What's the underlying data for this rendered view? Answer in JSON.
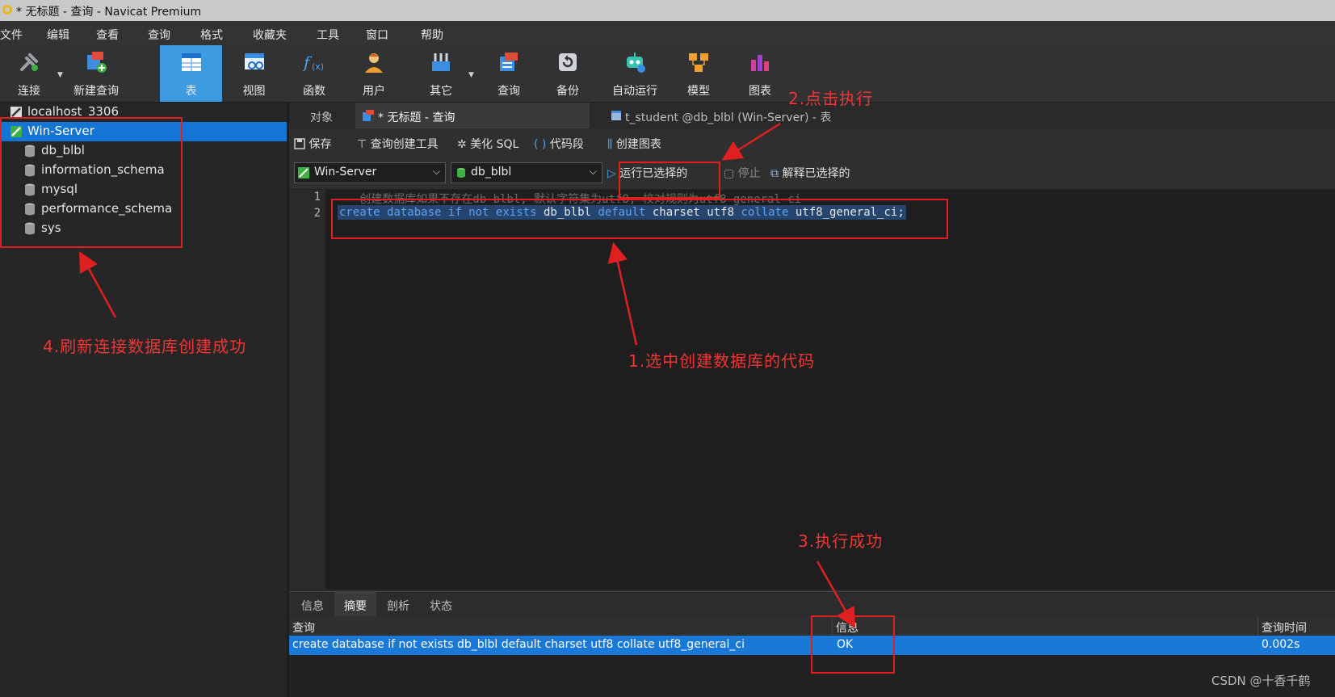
{
  "window": {
    "title": "* 无标题 - 查询 - Navicat Premium"
  },
  "menu": [
    "文件",
    "编辑",
    "查看",
    "查询",
    "格式",
    "收藏夹",
    "工具",
    "窗口",
    "帮助"
  ],
  "toolbar": {
    "connect": "连接",
    "new_query": "新建查询",
    "table": "表",
    "view": "视图",
    "function": "函数",
    "user": "用户",
    "other": "其它",
    "query": "查询",
    "backup": "备份",
    "automation": "自动运行",
    "model": "模型",
    "chart": "图表"
  },
  "tree": {
    "localhost": "localhost_3306",
    "server": "Win-Server",
    "databases": [
      "db_blbl",
      "information_schema",
      "mysql",
      "performance_schema",
      "sys"
    ]
  },
  "tabs": {
    "objects": "对象",
    "query_tab": "* 无标题 - 查询",
    "table_tab": "t_student @db_blbl (Win-Server) - 表"
  },
  "edit_toolbar": {
    "save": "保存",
    "query_builder": "查询创建工具",
    "beautify": "美化 SQL",
    "snippet": "代码段",
    "create_chart": "创建图表"
  },
  "conn_bar": {
    "connection": "Win-Server",
    "database": "db_blbl",
    "run_selected": "运行已选择的",
    "stop": "停止",
    "explain": "解释已选择的"
  },
  "editor": {
    "line_numbers": [
      "1",
      "2"
    ],
    "line1": "-- 创建数据库如果不存在db_blbl, 默认字符集为utf8, 校对规则为utf8_general_ci",
    "line2_tokens": {
      "t1": "create",
      "t2": "database",
      "t3": "if",
      "t4": "not",
      "t5": "exists",
      "t6": "db_blbl",
      "t7": "default",
      "t8": "charset",
      "t9": "utf8",
      "t10": "collate",
      "t11": "utf8_general_ci;"
    }
  },
  "results": {
    "tabs": [
      "信息",
      "摘要",
      "剖析",
      "状态"
    ],
    "headers": {
      "query": "查询",
      "info": "信息",
      "time": "查询时间"
    },
    "row": {
      "query": "create database if not exists db_blbl default charset utf8 collate utf8_general_ci",
      "info": "OK",
      "time": "0.002s"
    }
  },
  "annotations": {
    "a1": "1.选中创建数据库的代码",
    "a2": "2.点击执行",
    "a3": "3.执行成功",
    "a4": "4.刷新连接数据库创建成功"
  },
  "watermark": "CSDN @十香千鹤",
  "colors": {
    "accent": "#1575d4",
    "annotation": "#e02020",
    "toolbar_active": "#3f9be0"
  }
}
